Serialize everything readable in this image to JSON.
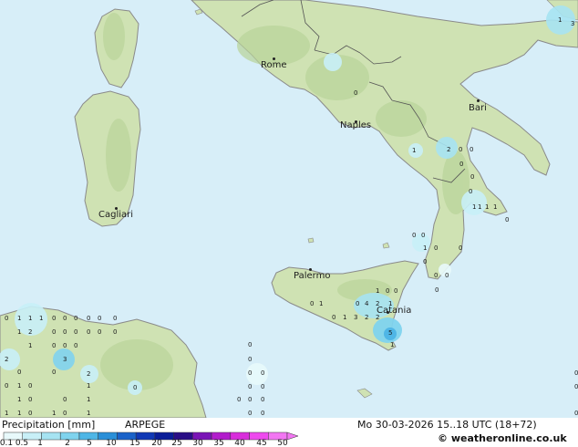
{
  "map": {
    "cities": [
      {
        "name": "Rome"
      },
      {
        "name": "Naples"
      },
      {
        "name": "Bari"
      },
      {
        "name": "Cagliari"
      },
      {
        "name": "Palermo"
      },
      {
        "name": "Catania"
      }
    ]
  },
  "legend": {
    "title": "Precipitation [mm]",
    "model": "ARPEGE",
    "datetime": "Mo 30-03-2026 15..18 UTC (18+72)",
    "credit": "© weatheronline.co.uk",
    "scale_labels": [
      "0.1",
      "0.5",
      "1",
      "2",
      "5",
      "10",
      "15",
      "20",
      "25",
      "30",
      "35",
      "40",
      "45",
      "50"
    ],
    "scale_colors": [
      "#e8f9fb",
      "#c8eff7",
      "#a6e3f2",
      "#7fd3ee",
      "#4fb6e6",
      "#2a8fd8",
      "#1a62c9",
      "#1038b5",
      "#0a1d98",
      "#2a0e86",
      "#7a14b6",
      "#b21ccc",
      "#d82edb",
      "#ee4aee",
      "#f276f2"
    ]
  }
}
